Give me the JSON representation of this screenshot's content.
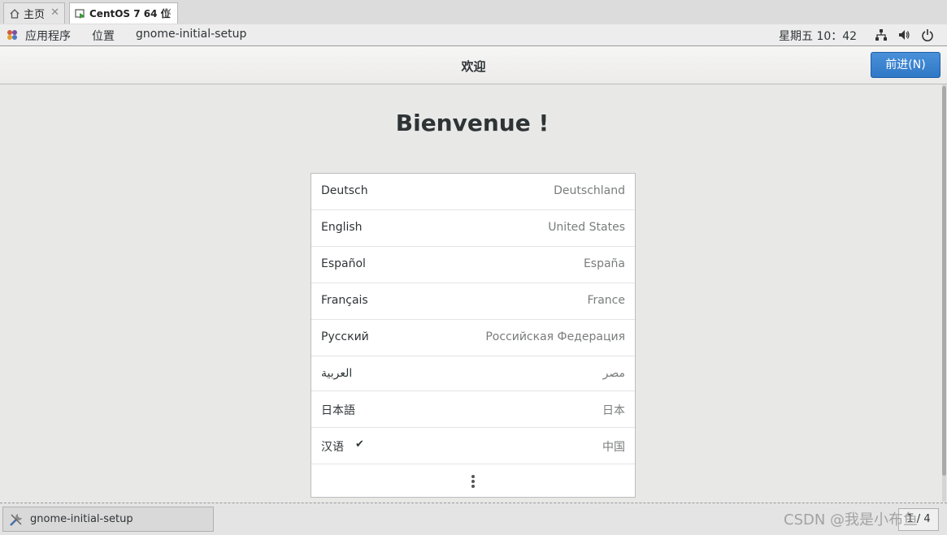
{
  "vm_tabs": [
    {
      "label": "主页",
      "icon": "home-icon"
    },
    {
      "label": "CentOS 7 64 位",
      "icon": "vm-icon"
    }
  ],
  "top_bar": {
    "applications": "应用程序",
    "places": "位置",
    "app_name": "gnome-initial-setup",
    "clock": "星期五 10：42"
  },
  "header": {
    "title": "欢迎",
    "next_button": "前进(N)"
  },
  "welcome": {
    "heading": "Bienvenue !"
  },
  "languages": [
    {
      "name": "Deutsch",
      "country": "Deutschland",
      "selected": false
    },
    {
      "name": "English",
      "country": "United States",
      "selected": false
    },
    {
      "name": "Español",
      "country": "España",
      "selected": false
    },
    {
      "name": "Français",
      "country": "France",
      "selected": false
    },
    {
      "name": "Русский",
      "country": "Российская Федерация",
      "selected": false
    },
    {
      "name": "العربية",
      "country": "مصر",
      "selected": false
    },
    {
      "name": "日本語",
      "country": "日本",
      "selected": false
    },
    {
      "name": "汉语",
      "country": "中国",
      "selected": true
    }
  ],
  "taskbar": {
    "task_label": "gnome-initial-setup",
    "pager": "1 / 4"
  },
  "watermark": "CSDN @我是小布鱼",
  "colors": {
    "accent": "#3584e4",
    "background": "#e8e8e7"
  }
}
